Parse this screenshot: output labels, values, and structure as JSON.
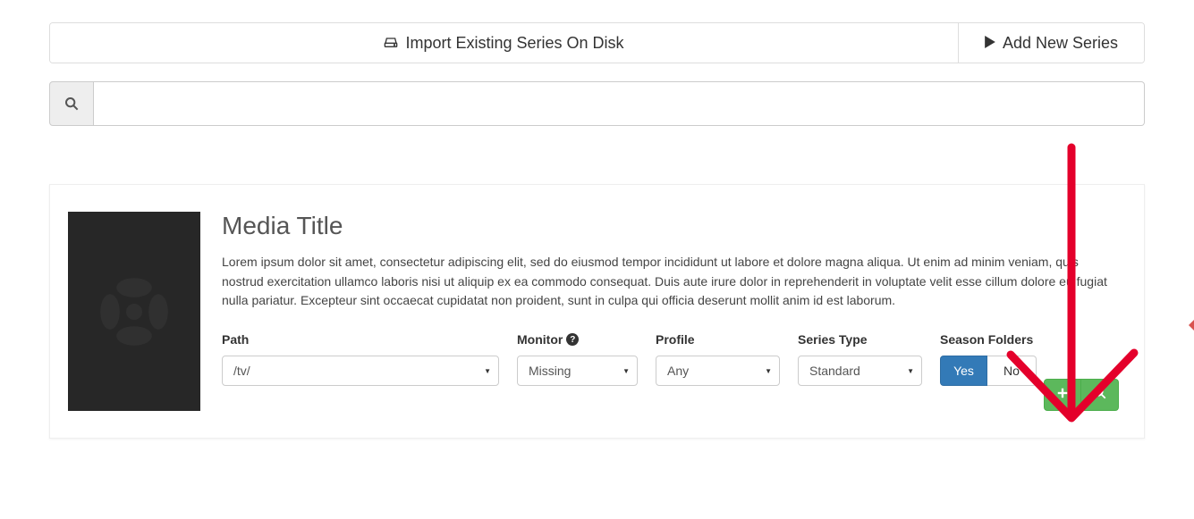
{
  "header": {
    "import_label": "Import Existing Series On Disk",
    "add_new_label": "Add New Series"
  },
  "search": {
    "placeholder": ""
  },
  "result": {
    "title": "Media Title",
    "description": "Lorem ipsum dolor sit amet, consectetur adipiscing elit, sed do eiusmod tempor incididunt ut labore et dolore magna aliqua. Ut enim ad minim veniam, quis nostrud exercitation ullamco laboris nisi ut aliquip ex ea commodo consequat. Duis aute irure dolor in reprehenderit in voluptate velit esse cillum dolore eu fugiat nulla pariatur. Excepteur sint occaecat cupidatat non proident, sunt in culpa qui officia deserunt mollit anim id est laborum.",
    "fields": {
      "path": {
        "label": "Path",
        "value": "/tv/"
      },
      "monitor": {
        "label": "Monitor",
        "value": "Missing"
      },
      "profile": {
        "label": "Profile",
        "value": "Any"
      },
      "type": {
        "label": "Series Type",
        "value": "Standard"
      },
      "season": {
        "label": "Season Folders",
        "yes": "Yes",
        "no": "No"
      }
    }
  },
  "colors": {
    "primary": "#337ab7",
    "success": "#5cb85c",
    "annotation": "#e4002b"
  }
}
